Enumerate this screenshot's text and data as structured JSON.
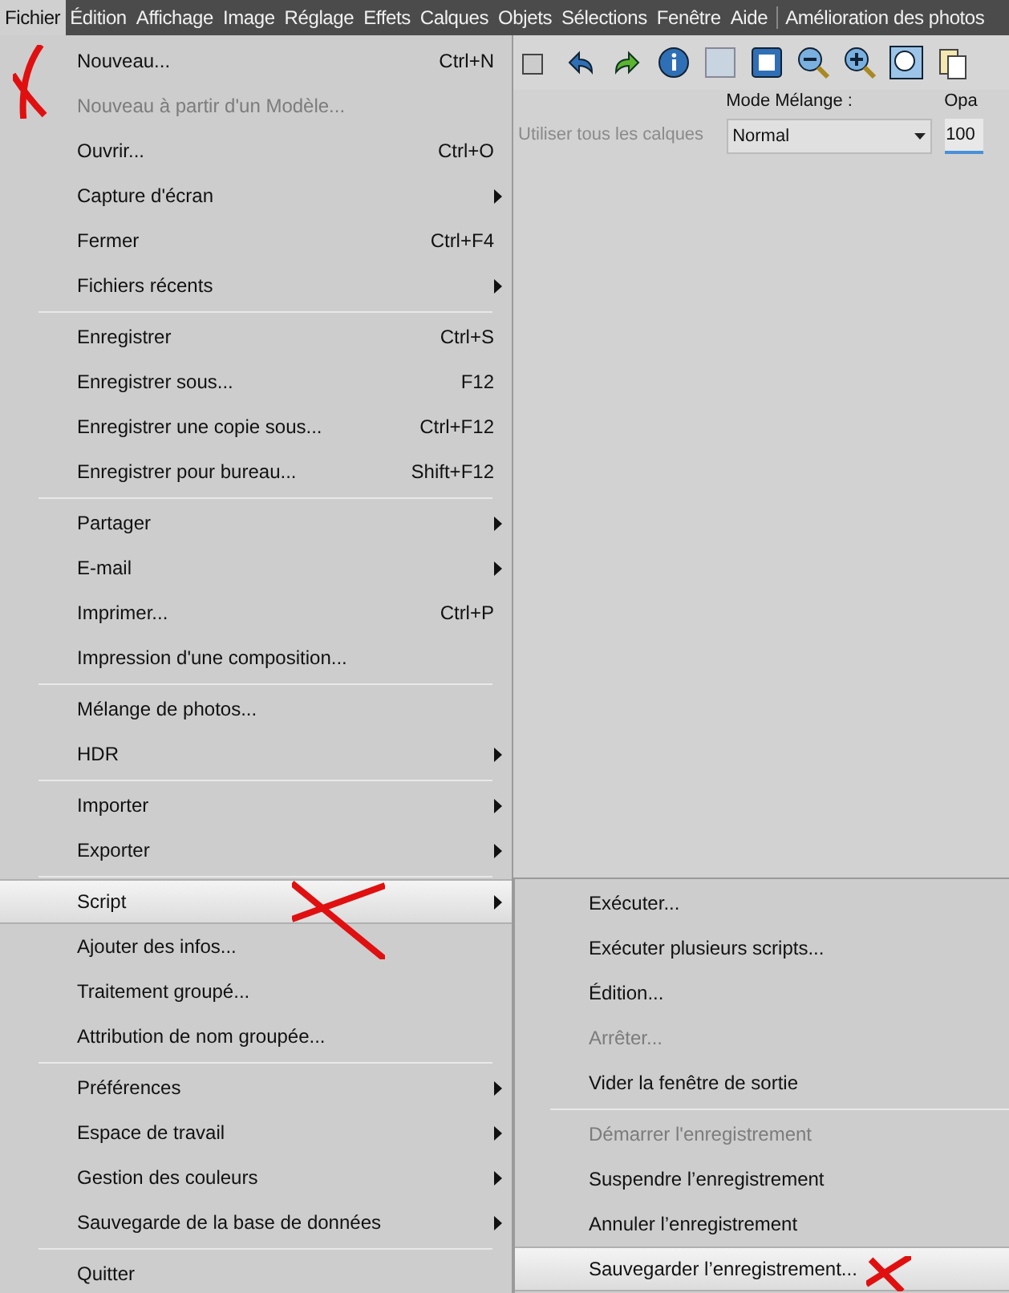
{
  "menubar": [
    {
      "label": "Fichier",
      "selected": true
    },
    {
      "label": "Édition",
      "selected": false
    },
    {
      "label": "Affichage",
      "selected": false
    },
    {
      "label": "Image",
      "selected": false
    },
    {
      "label": "Réglage",
      "selected": false
    },
    {
      "label": "Effets",
      "selected": false
    },
    {
      "label": "Calques",
      "selected": false
    },
    {
      "label": "Objets",
      "selected": false
    },
    {
      "label": "Sélections",
      "selected": false
    },
    {
      "label": "Fenêtre",
      "selected": false
    },
    {
      "label": "Aide",
      "selected": false
    },
    {
      "label": "Amélioration des photos",
      "selected": false
    }
  ],
  "options_bar": {
    "use_all_layers": "Utiliser tous les calques",
    "blend_label": "Mode Mélange :",
    "blend_value": "Normal",
    "opacity_label": "Opa",
    "opacity_value": "100"
  },
  "file_menu": [
    {
      "kind": "item",
      "label": "Nouveau...",
      "shortcut": "Ctrl+N",
      "submenu": false,
      "disabled": false,
      "selected": false
    },
    {
      "kind": "item",
      "label": "Nouveau à partir d'un Modèle...",
      "submenu": false,
      "disabled": true,
      "selected": false
    },
    {
      "kind": "item",
      "label": "Ouvrir...",
      "shortcut": "Ctrl+O",
      "submenu": false,
      "disabled": false,
      "selected": false
    },
    {
      "kind": "item",
      "label": "Capture d'écran",
      "submenu": true,
      "disabled": false,
      "selected": false
    },
    {
      "kind": "item",
      "label": "Fermer",
      "shortcut": "Ctrl+F4",
      "submenu": false,
      "disabled": false,
      "selected": false
    },
    {
      "kind": "item",
      "label": "Fichiers récents",
      "submenu": true,
      "disabled": false,
      "selected": false
    },
    {
      "kind": "separator"
    },
    {
      "kind": "item",
      "label": "Enregistrer",
      "shortcut": "Ctrl+S",
      "submenu": false,
      "disabled": false,
      "selected": false
    },
    {
      "kind": "item",
      "label": "Enregistrer sous...",
      "shortcut": "F12",
      "submenu": false,
      "disabled": false,
      "selected": false
    },
    {
      "kind": "item",
      "label": "Enregistrer une copie sous...",
      "shortcut": "Ctrl+F12",
      "submenu": false,
      "disabled": false,
      "selected": false
    },
    {
      "kind": "item",
      "label": "Enregistrer pour bureau...",
      "shortcut": "Shift+F12",
      "submenu": false,
      "disabled": false,
      "selected": false
    },
    {
      "kind": "separator"
    },
    {
      "kind": "item",
      "label": "Partager",
      "submenu": true,
      "disabled": false,
      "selected": false
    },
    {
      "kind": "item",
      "label": "E-mail",
      "submenu": true,
      "disabled": false,
      "selected": false
    },
    {
      "kind": "item",
      "label": "Imprimer...",
      "shortcut": "Ctrl+P",
      "submenu": false,
      "disabled": false,
      "selected": false
    },
    {
      "kind": "item",
      "label": "Impression d'une composition...",
      "submenu": false,
      "disabled": false,
      "selected": false
    },
    {
      "kind": "separator"
    },
    {
      "kind": "item",
      "label": "Mélange de photos...",
      "submenu": false,
      "disabled": false,
      "selected": false
    },
    {
      "kind": "item",
      "label": "HDR",
      "submenu": true,
      "disabled": false,
      "selected": false
    },
    {
      "kind": "separator"
    },
    {
      "kind": "item",
      "label": "Importer",
      "submenu": true,
      "disabled": false,
      "selected": false
    },
    {
      "kind": "item",
      "label": "Exporter",
      "submenu": true,
      "disabled": false,
      "selected": false
    },
    {
      "kind": "separator"
    },
    {
      "kind": "item",
      "label": "Script",
      "submenu": true,
      "disabled": false,
      "selected": true
    },
    {
      "kind": "item",
      "label": "Ajouter des infos...",
      "submenu": false,
      "disabled": false,
      "selected": false
    },
    {
      "kind": "item",
      "label": "Traitement groupé...",
      "submenu": false,
      "disabled": false,
      "selected": false
    },
    {
      "kind": "item",
      "label": "Attribution de nom groupée...",
      "submenu": false,
      "disabled": false,
      "selected": false
    },
    {
      "kind": "separator"
    },
    {
      "kind": "item",
      "label": "Préférences",
      "submenu": true,
      "disabled": false,
      "selected": false
    },
    {
      "kind": "item",
      "label": "Espace de travail",
      "submenu": true,
      "disabled": false,
      "selected": false
    },
    {
      "kind": "item",
      "label": "Gestion des couleurs",
      "submenu": true,
      "disabled": false,
      "selected": false
    },
    {
      "kind": "item",
      "label": "Sauvegarde de la base de données",
      "submenu": true,
      "disabled": false,
      "selected": false
    },
    {
      "kind": "separator"
    },
    {
      "kind": "item",
      "label": "Quitter",
      "submenu": false,
      "disabled": false,
      "selected": false
    }
  ],
  "script_submenu": [
    {
      "kind": "item",
      "label": "Exécuter...",
      "disabled": false,
      "selected": false
    },
    {
      "kind": "item",
      "label": "Exécuter plusieurs scripts...",
      "disabled": false,
      "selected": false
    },
    {
      "kind": "item",
      "label": "Édition...",
      "disabled": false,
      "selected": false
    },
    {
      "kind": "item",
      "label": "Arrêter...",
      "disabled": true,
      "selected": false
    },
    {
      "kind": "item",
      "label": "Vider la fenêtre de sortie",
      "disabled": false,
      "selected": false
    },
    {
      "kind": "separator"
    },
    {
      "kind": "item",
      "label": "Démarrer l'enregistrement",
      "disabled": true,
      "selected": false
    },
    {
      "kind": "item",
      "label": "Suspendre l’enregistrement",
      "disabled": false,
      "selected": false
    },
    {
      "kind": "item",
      "label": "Annuler l’enregistrement",
      "disabled": false,
      "selected": false
    },
    {
      "kind": "item",
      "label": "Sauvegarder l’enregistrement...",
      "disabled": false,
      "selected": true
    }
  ]
}
